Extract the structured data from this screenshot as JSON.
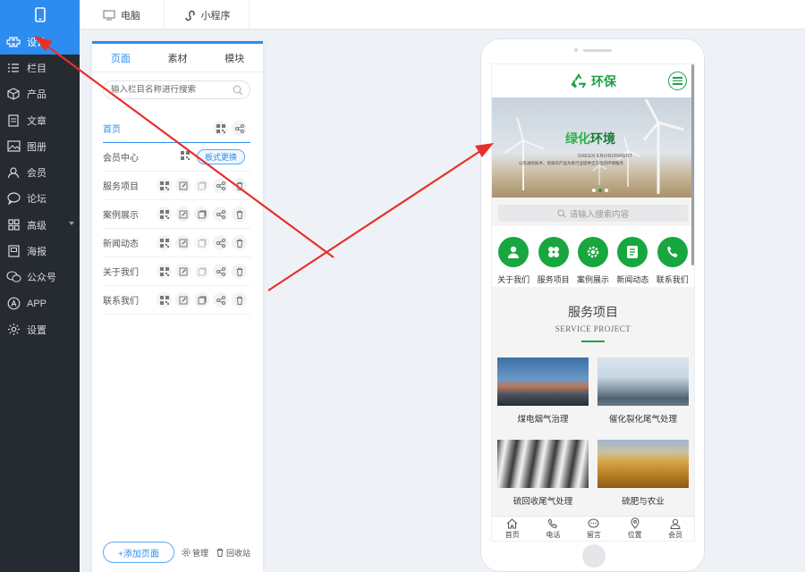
{
  "sidebar": {
    "items": [
      {
        "label": "设计",
        "icon": "design-icon",
        "active": true
      },
      {
        "label": "栏目",
        "icon": "list-icon"
      },
      {
        "label": "产品",
        "icon": "box-icon"
      },
      {
        "label": "文章",
        "icon": "document-icon"
      },
      {
        "label": "图册",
        "icon": "image-icon"
      },
      {
        "label": "会员",
        "icon": "user-icon"
      },
      {
        "label": "论坛",
        "icon": "chat-icon"
      },
      {
        "label": "高级",
        "icon": "grid-icon"
      },
      {
        "label": "海报",
        "icon": "poster-icon"
      },
      {
        "label": "公众号",
        "icon": "wechat-icon"
      },
      {
        "label": "APP",
        "icon": "app-icon"
      },
      {
        "label": "设置",
        "icon": "gear-icon"
      }
    ]
  },
  "topbar": {
    "tabs": [
      {
        "label": "电脑",
        "icon": "monitor-icon"
      },
      {
        "label": "小程序",
        "icon": "miniprogram-icon"
      }
    ]
  },
  "panel": {
    "tabs": [
      {
        "label": "页面",
        "active": true
      },
      {
        "label": "素材"
      },
      {
        "label": "模块"
      }
    ],
    "search_placeholder": "输入栏目名称进行搜索",
    "rows": [
      {
        "label": "首页"
      },
      {
        "label": "会员中心",
        "badge": "板式更换"
      },
      {
        "label": "服务项目"
      },
      {
        "label": "案例展示"
      },
      {
        "label": "新闻动态"
      },
      {
        "label": "关于我们"
      },
      {
        "label": "联系我们"
      }
    ],
    "add_button": "+添加页面",
    "manage": "管理",
    "recycle": "回收站"
  },
  "phone": {
    "logo_text": "环保",
    "banner": {
      "title_green": "绿化",
      "title_dark": "环境",
      "subtitle": "GREEN ENVIRONMENT",
      "desc": "以先进的技术、优质的产品为各行业提供全方位的环保服务"
    },
    "search_placeholder": "请输入搜索内容",
    "quick": [
      {
        "label": "关于我们",
        "icon": "person-icon"
      },
      {
        "label": "服务项目",
        "icon": "clover-icon"
      },
      {
        "label": "案例展示",
        "icon": "cog-icon"
      },
      {
        "label": "新闻动态",
        "icon": "news-icon"
      },
      {
        "label": "联系我们",
        "icon": "phone-icon"
      }
    ],
    "section": {
      "title": "服务项目",
      "subtitle": "SERVICE PROJECT",
      "cards": [
        {
          "label": "煤电烟气治理"
        },
        {
          "label": "催化裂化尾气处理"
        },
        {
          "label": "硫回收尾气处理"
        },
        {
          "label": "硫肥与农业"
        }
      ]
    },
    "bottom_nav": [
      {
        "label": "首页",
        "icon": "home-icon"
      },
      {
        "label": "电话",
        "icon": "telephone-icon"
      },
      {
        "label": "留言",
        "icon": "message-icon"
      },
      {
        "label": "位置",
        "icon": "location-icon"
      },
      {
        "label": "会员",
        "icon": "member-icon"
      }
    ]
  },
  "colors": {
    "accent": "#2d8cf0",
    "sidebar_bg": "#262b31",
    "brand_green": "#1fa046",
    "arrow_red": "#e8302a"
  }
}
